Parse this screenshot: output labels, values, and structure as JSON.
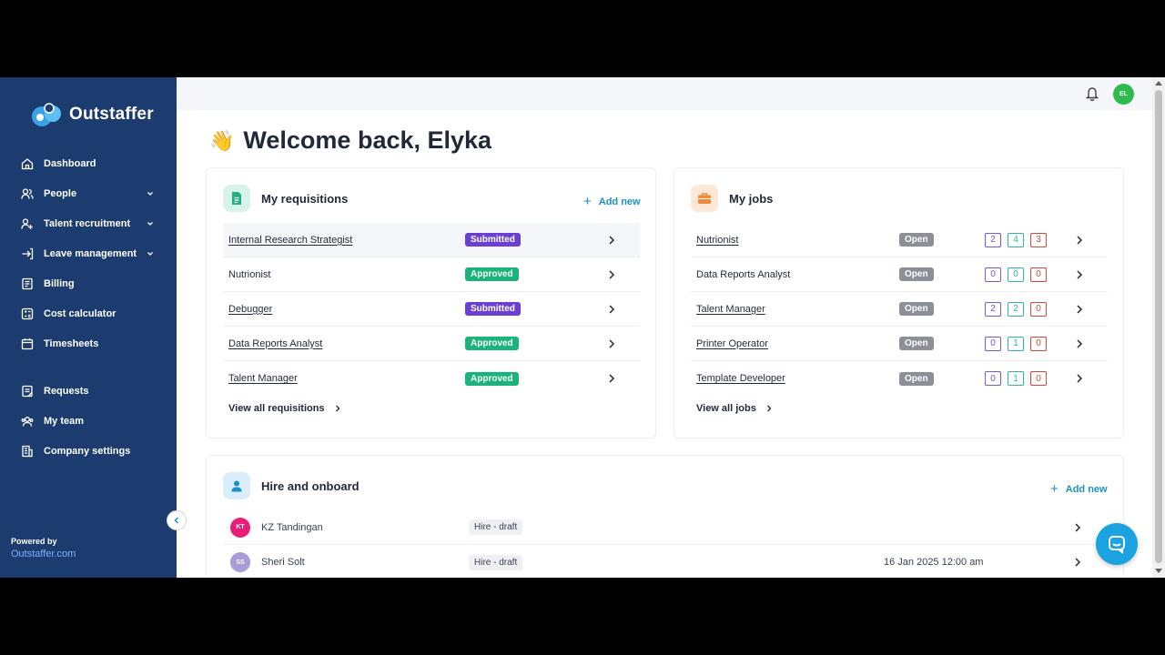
{
  "brand": {
    "name": "Outstaffer"
  },
  "sidebar": {
    "items": [
      {
        "label": "Dashboard",
        "icon": "home-icon"
      },
      {
        "label": "People",
        "icon": "people-icon",
        "expandable": true
      },
      {
        "label": "Talent recruitment",
        "icon": "recruitment-icon",
        "expandable": true
      },
      {
        "label": "Leave management",
        "icon": "leave-icon",
        "expandable": true
      },
      {
        "label": "Billing",
        "icon": "billing-icon"
      },
      {
        "label": "Cost calculator",
        "icon": "calculator-icon"
      },
      {
        "label": "Timesheets",
        "icon": "calendar-icon"
      },
      {
        "label": "Requests",
        "icon": "requests-icon"
      },
      {
        "label": "My team",
        "icon": "team-icon"
      },
      {
        "label": "Company settings",
        "icon": "settings-icon"
      }
    ],
    "powered_by": "Powered by",
    "powered_link": "Outstaffer.com"
  },
  "topbar": {
    "avatar_initials": "EL"
  },
  "welcome": {
    "wave": "👋",
    "text": "Welcome back, Elyka"
  },
  "requisitions": {
    "title": "My requisitions",
    "add_new": "Add new",
    "rows": [
      {
        "name": "Internal Research Strategist",
        "status": "Submitted"
      },
      {
        "name": "Nutrionist",
        "status": "Approved"
      },
      {
        "name": "Debugger",
        "status": "Submitted"
      },
      {
        "name": "Data Reports Analyst",
        "status": "Approved"
      },
      {
        "name": "Talent Manager",
        "status": "Approved"
      }
    ],
    "view_all": "View all requisitions"
  },
  "jobs": {
    "title": "My jobs",
    "rows": [
      {
        "name": "Nutrionist",
        "status": "Open",
        "counts": [
          "2",
          "4",
          "3"
        ]
      },
      {
        "name": "Data Reports Analyst",
        "status": "Open",
        "counts": [
          "0",
          "0",
          "0"
        ]
      },
      {
        "name": "Talent Manager",
        "status": "Open",
        "counts": [
          "2",
          "2",
          "0"
        ]
      },
      {
        "name": "Printer Operator",
        "status": "Open",
        "counts": [
          "0",
          "1",
          "0"
        ]
      },
      {
        "name": "Template Developer",
        "status": "Open",
        "counts": [
          "0",
          "1",
          "0"
        ]
      }
    ],
    "view_all": "View all jobs"
  },
  "hire": {
    "title": "Hire and onboard",
    "add_new": "Add new",
    "rows": [
      {
        "initials": "KT",
        "name": "KZ Tandingan",
        "status": "Hire - draft",
        "date": "",
        "avatar_color": "#e91e7a"
      },
      {
        "initials": "SS",
        "name": "Sheri Solt",
        "status": "Hire - draft",
        "date": "16 Jan 2025 12:00 am",
        "avatar_color": "#a79bd8"
      }
    ]
  },
  "colors": {
    "sidebar": "#1c3b6e",
    "accent": "#1b8fc9",
    "submitted": "#6b3fd4",
    "approved": "#1ab37a",
    "open": "#8a8f98"
  }
}
